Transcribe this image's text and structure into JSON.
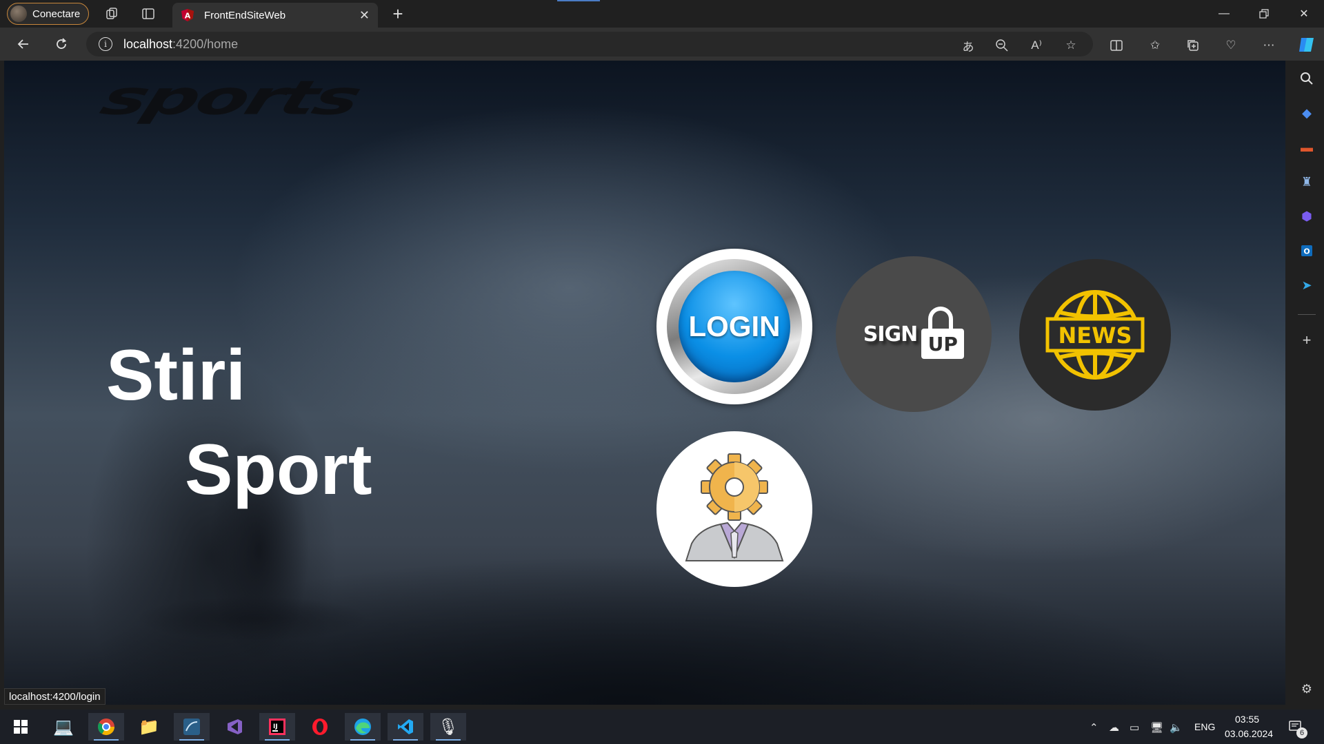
{
  "browser": {
    "profile_label": "Conectare",
    "tab_title": "FrontEndSiteWeb",
    "url_host": "localhost",
    "url_path": ":4200/home",
    "status_url": "localhost:4200/login"
  },
  "page": {
    "logo_text": "sports",
    "headline_line1": "Stiri",
    "headline_line2": "Sport",
    "buttons": {
      "login_label": "LOGIN",
      "signup_label": "SIGN",
      "signup_lock_label": "UP",
      "news_label": "NEWS"
    }
  },
  "taskbar": {
    "time": "03:55",
    "date": "03.06.2024",
    "language": "ENG",
    "notification_count": "6"
  },
  "colors": {
    "accent_blue": "#0a8fe6",
    "news_yellow": "#f2c200",
    "profile_border": "#c8873b"
  }
}
